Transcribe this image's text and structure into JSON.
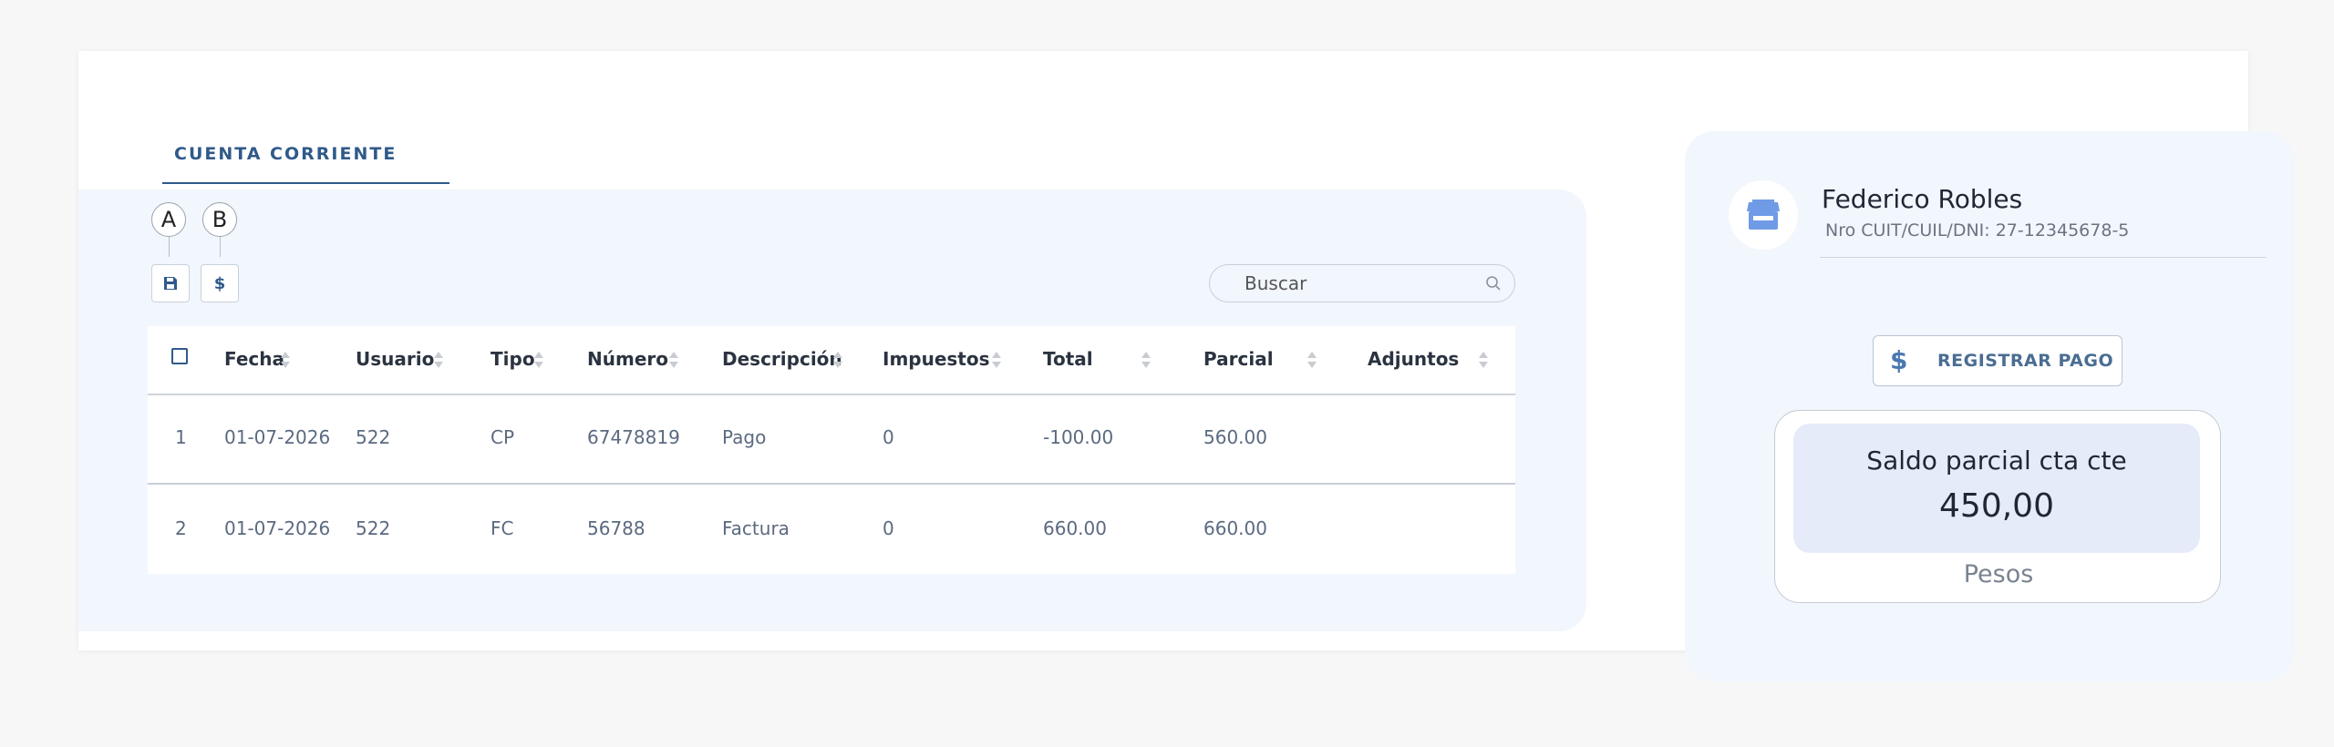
{
  "tab": {
    "label": "CUENTA CORRIENTE"
  },
  "toolbar": {
    "markers": [
      "A",
      "B"
    ],
    "save_icon": "floppy-disk-icon",
    "payment_icon_label": "$"
  },
  "search": {
    "placeholder": "Buscar",
    "icon": "search-icon"
  },
  "table": {
    "headers": [
      "Fecha",
      "Usuario",
      "Tipo",
      "Número",
      "Descripción",
      "Impuestos",
      "Total",
      "Parcial",
      "Adjuntos"
    ],
    "rows": [
      {
        "index": "1",
        "fecha": "01-07-2026",
        "usuario": "522",
        "tipo": "CP",
        "numero": "67478819",
        "descripcion": "Pago",
        "impuestos": "0",
        "total": "-100.00",
        "parcial": "560.00",
        "adjuntos": ""
      },
      {
        "index": "2",
        "fecha": "01-07-2026",
        "usuario": "522",
        "tipo": "FC",
        "numero": "56788",
        "descripcion": "Factura",
        "impuestos": "0",
        "total": "660.00",
        "parcial": "660.00",
        "adjuntos": ""
      }
    ]
  },
  "client": {
    "name": "Federico Robles",
    "id_text": "Nro CUIT/CUIL/DNI: 27-12345678-5",
    "avatar_icon": "store-icon"
  },
  "actions": {
    "register_payment_label": "REGISTRAR PAGO",
    "register_payment_icon": "$"
  },
  "balance": {
    "title": "Saldo parcial cta cte",
    "value": "450,00",
    "currency": "Pesos"
  },
  "colors": {
    "accent": "#2f5a8a",
    "panel": "#f2f6fd",
    "balance_bg": "#e6ebfa",
    "avatar_icon": "#6f9ae6"
  }
}
